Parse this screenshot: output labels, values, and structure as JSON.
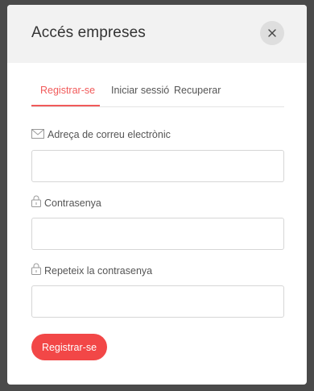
{
  "modal": {
    "title": "Accés empreses",
    "close_label": "×"
  },
  "tabs": [
    {
      "label": "Registrar-se",
      "active": true
    },
    {
      "label": "Iniciar sessió",
      "active": false
    },
    {
      "label": "Recuperar",
      "active": false
    }
  ],
  "form": {
    "email_label": "Adreça de correu electrònic",
    "password_label": "Contrasenya",
    "repeat_password_label": "Repeteix la contrasenya",
    "email_value": "",
    "password_value": "",
    "repeat_password_value": "",
    "submit_label": "Registrar-se"
  },
  "icons": {
    "email": "envelope-icon",
    "password": "lock-icon",
    "repeat_password": "lock-icon",
    "close": "close-icon"
  },
  "colors": {
    "accent": "#f24747",
    "tab_active": "#f15a5a",
    "header_bg": "#f2f2f2",
    "overlay": "#4a4a4a"
  }
}
